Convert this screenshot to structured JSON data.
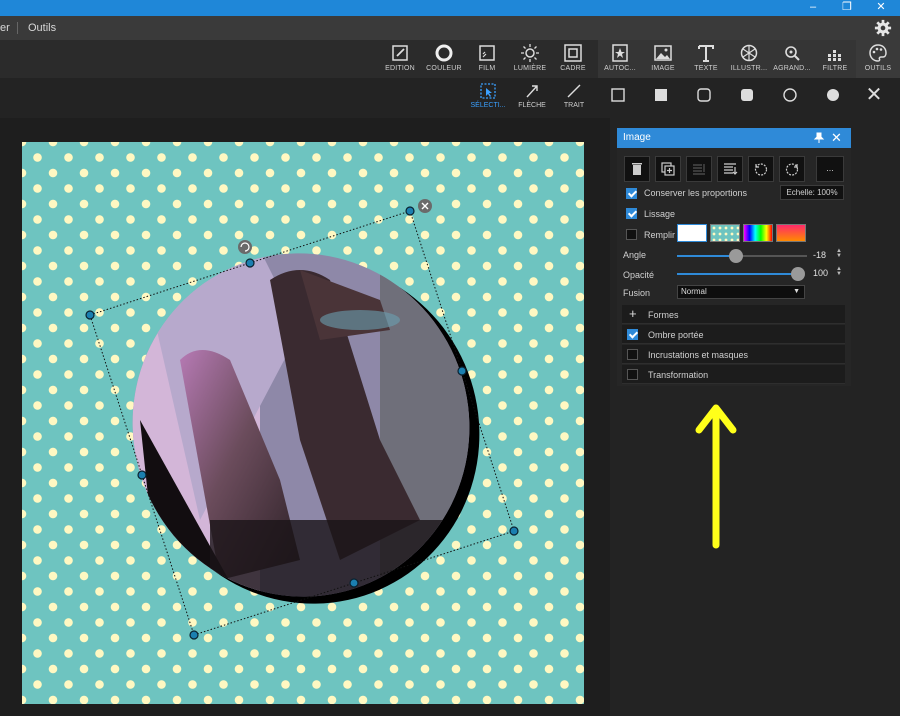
{
  "window": {
    "controls": {
      "minimize": "–",
      "maximize": "❐",
      "close": "✕"
    }
  },
  "menu": {
    "items": [
      "er",
      "Outils"
    ]
  },
  "toolbar": {
    "tools": [
      {
        "label": "EDITION",
        "icon": "edit-icon"
      },
      {
        "label": "COULEUR",
        "icon": "color-circle-icon"
      },
      {
        "label": "FILM",
        "icon": "film-icon"
      },
      {
        "label": "LUMIÈRE",
        "icon": "sun-icon"
      },
      {
        "label": "CADRE",
        "icon": "frame-icon"
      },
      {
        "label": "AUTOC...",
        "icon": "sticker-icon"
      },
      {
        "label": "IMAGE",
        "icon": "image-icon"
      },
      {
        "label": "TEXTE",
        "icon": "text-icon"
      },
      {
        "label": "ILLUSTR...",
        "icon": "illustration-icon"
      },
      {
        "label": "AGRAND...",
        "icon": "zoom-icon"
      },
      {
        "label": "FILTRE",
        "icon": "filter-icon"
      },
      {
        "label": "OUTILS",
        "icon": "palette-icon"
      }
    ]
  },
  "subtoolbar": {
    "tools": [
      {
        "label": "SÉLECTI...",
        "icon": "selection-icon"
      },
      {
        "label": "FLÈCHE",
        "icon": "arrow-icon"
      },
      {
        "label": "TRAIT",
        "icon": "line-icon"
      }
    ],
    "close": "✕"
  },
  "panel": {
    "title": "Image",
    "more_button": "...",
    "keep_proportions": "Conserver les proportions",
    "scale": "Echelle: 100%",
    "smoothing": "Lissage",
    "fill": "Remplir",
    "angle_label": "Angle",
    "angle_value": "-18",
    "opacity_label": "Opacité",
    "opacity_value": "100",
    "blend_label": "Fusion",
    "blend_value": "Normal",
    "sections": [
      {
        "label": "Formes",
        "type": "plus",
        "checked": false
      },
      {
        "label": "Ombre portée",
        "type": "check",
        "checked": true
      },
      {
        "label": "Incrustations et masques",
        "type": "check",
        "checked": false
      },
      {
        "label": "Transformation",
        "type": "check",
        "checked": false
      }
    ]
  },
  "colors": {
    "accent": "#2f8ad8",
    "annotation_arrow": "#ffff1a",
    "canvas_bg": "#6ec4c0",
    "polka_dot": "#fff8c2"
  }
}
